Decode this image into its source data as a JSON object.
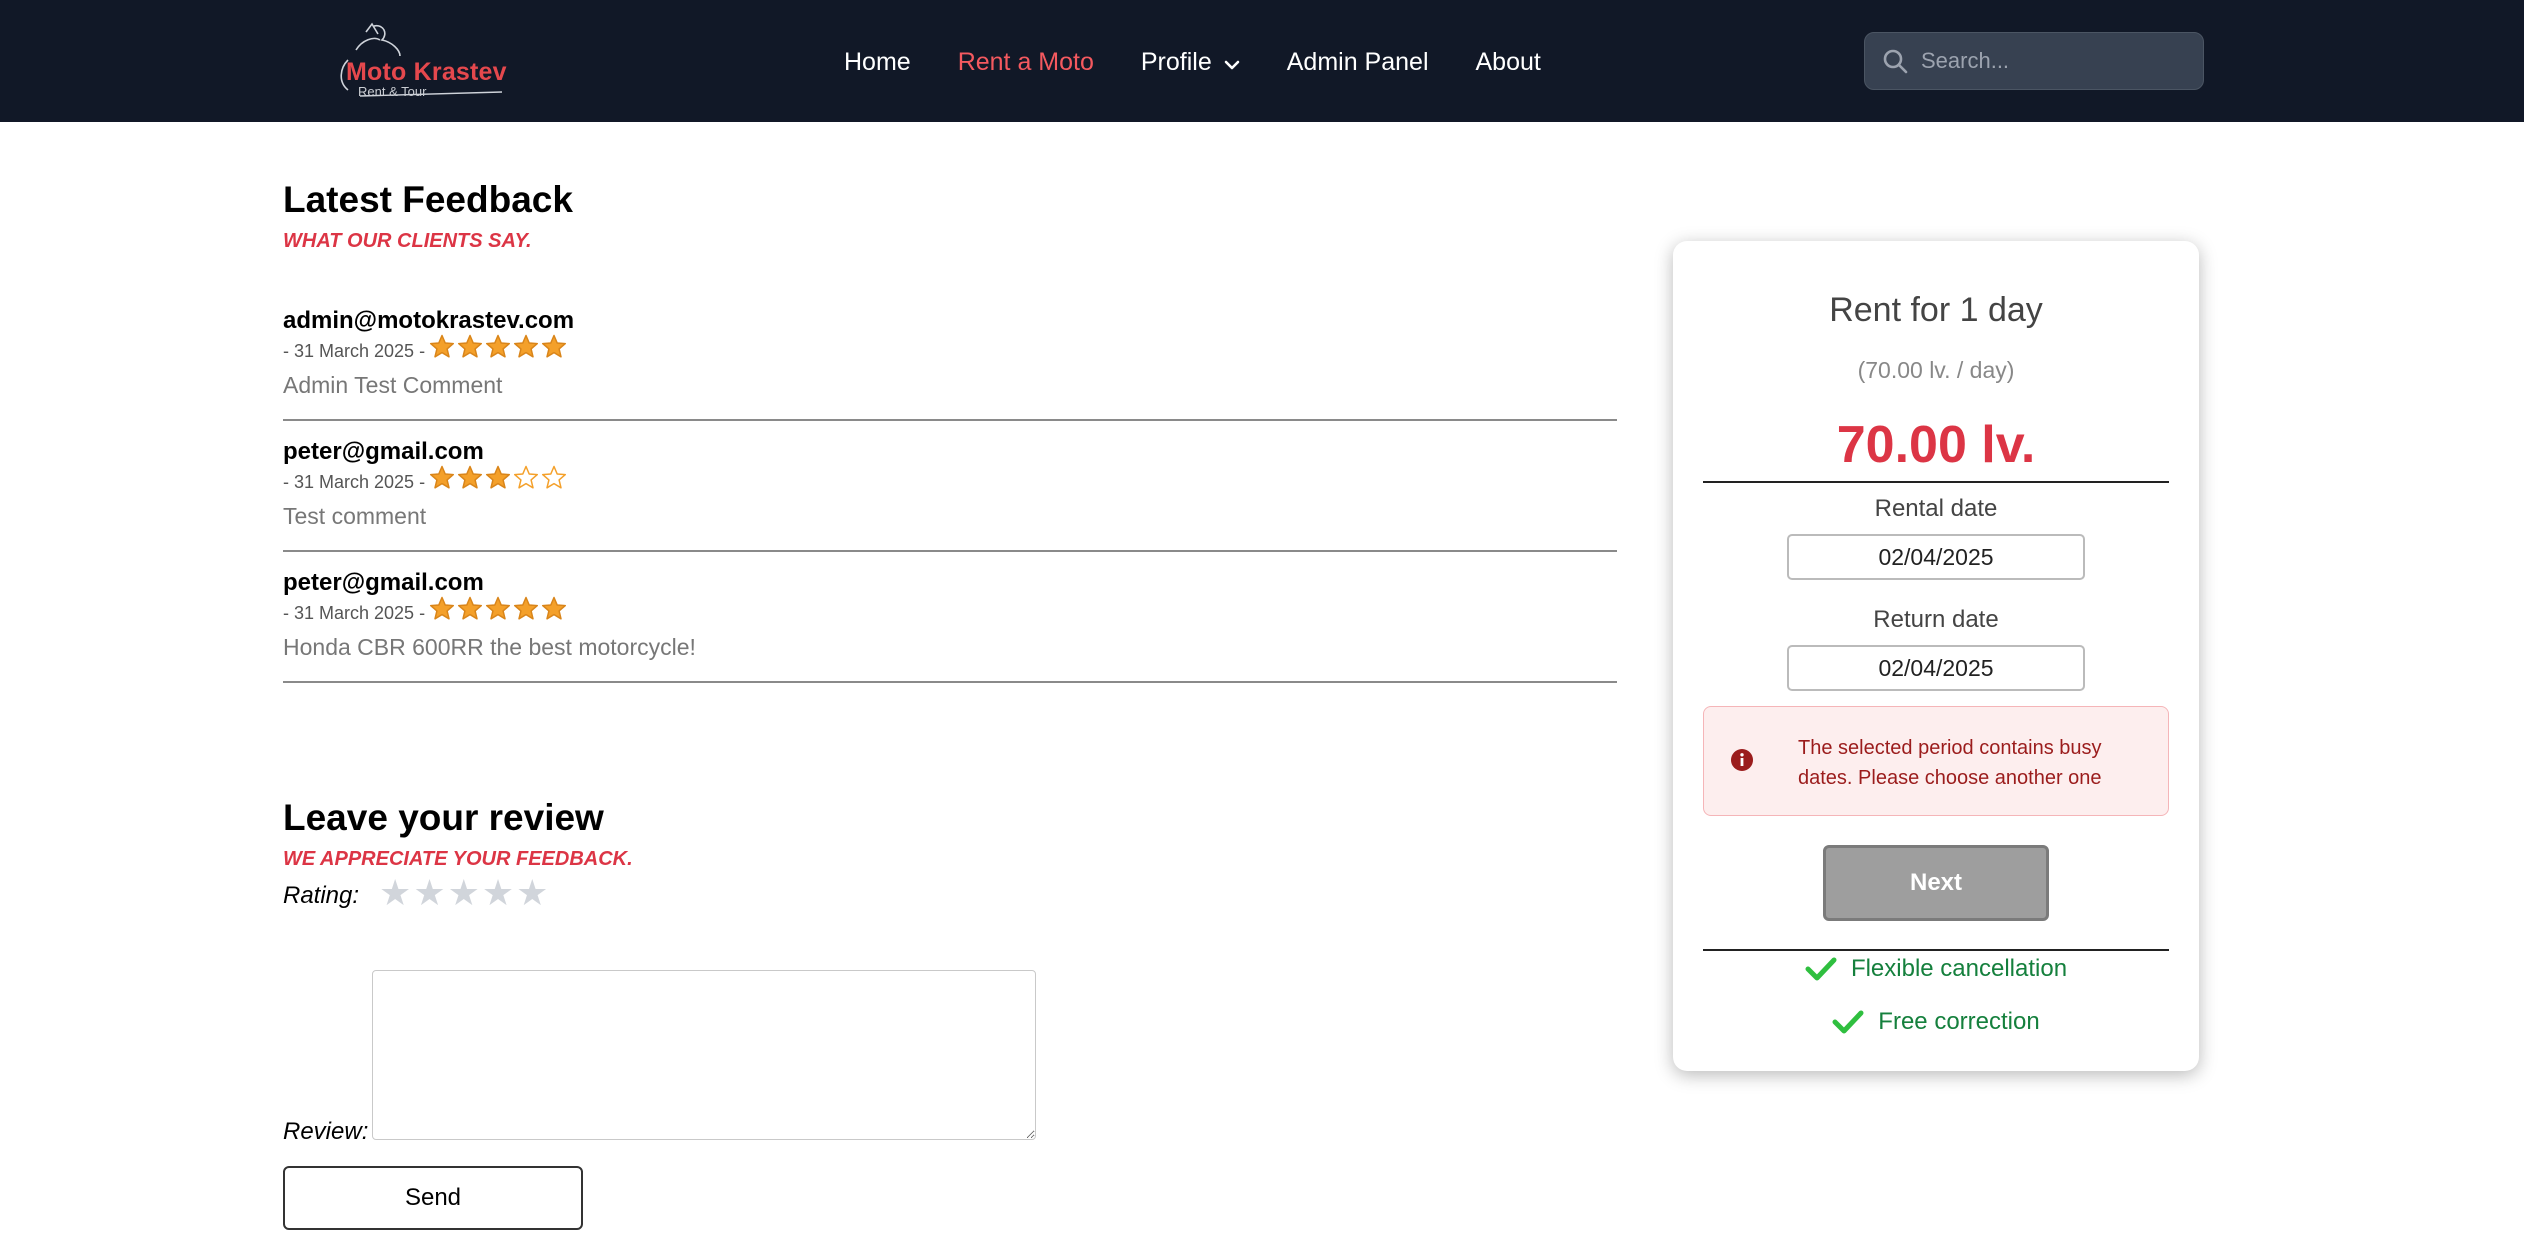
{
  "brand": {
    "name": "Moto Krastev",
    "tagline": "Rent & Tour"
  },
  "nav": {
    "links": [
      {
        "label": "Home"
      },
      {
        "label": "Rent a Moto"
      },
      {
        "label": "Profile"
      },
      {
        "label": "Admin Panel"
      },
      {
        "label": "About"
      }
    ],
    "active": "Rent a Moto",
    "search_placeholder": "Search..."
  },
  "feedback": {
    "title": "Latest Feedback",
    "subtitle": "WHAT OUR CLIENTS SAY.",
    "reviews": [
      {
        "email": "admin@motokrastev.com",
        "date": "- 31 March 2025 -",
        "rating": 5,
        "text": "Admin Test Comment"
      },
      {
        "email": "peter@gmail.com",
        "date": "- 31 March 2025 -",
        "rating": 3,
        "text": "Test comment"
      },
      {
        "email": "peter@gmail.com",
        "date": "- 31 March 2025 -",
        "rating": 5,
        "text": "Honda CBR 600RR the best motorcycle!"
      }
    ]
  },
  "leave_review": {
    "title": "Leave your review",
    "subtitle": "WE APPRECIATE YOUR FEEDBACK.",
    "rating_label": "Rating:",
    "review_label": "Review:",
    "review_value": "",
    "send_label": "Send"
  },
  "rent": {
    "title": "Rent for 1 day",
    "per_day": "(70.00 lv. / day)",
    "total": "70.00 lv.",
    "rental_date_label": "Rental date",
    "rental_date": "02/04/2025",
    "return_date_label": "Return date",
    "return_date": "02/04/2025",
    "alert": "The selected period contains busy dates. Please choose another one",
    "next_label": "Next",
    "perks": [
      "Flexible cancellation",
      "Free correction"
    ]
  },
  "colors": {
    "nav_bg": "#111827",
    "accent_red": "#dc3545",
    "star": "#f4a02a",
    "check": "#2fbf3f",
    "perk_text": "#15803d"
  }
}
